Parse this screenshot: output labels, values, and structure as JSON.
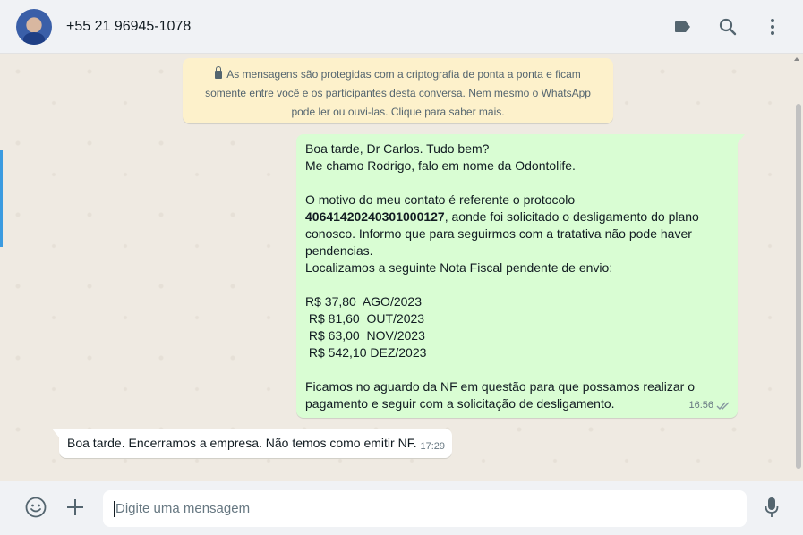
{
  "header": {
    "contact_name": "+55 21 96945-1078",
    "icons": [
      "label-icon",
      "search-icon",
      "menu-icon"
    ]
  },
  "encryption_notice": {
    "text": "As mensagens são protegidas com a criptografia de ponta a ponta e ficam somente entre você e os participantes desta conversa. Nem mesmo o WhatsApp pode ler ou ouvi-las. Clique para saber mais.",
    "line1": "As mensagens são protegidas com a criptografia de ponta a ponta e ficam",
    "line2": "somente entre você e os participantes desta conversa. Nem mesmo o WhatsApp",
    "line3": "pode ler ou ouvi-las. Clique para saber mais."
  },
  "messages": [
    {
      "direction": "outgoing",
      "lines": [
        "Boa tarde, Dr Carlos. Tudo bem?",
        "Me chamo Rodrigo, falo em nome da Odontolife.",
        "",
        "O motivo do meu contato é referente o protocolo",
        "",
        "conosco. Informo que para seguirmos com a tratativa não pode haver",
        "pendencias.",
        "Localizamos a seguinte Nota Fiscal pendente de envio:",
        "",
        "R$ 37,80  AGO/2023",
        " R$ 81,60  OUT/2023",
        " R$ 63,00  NOV/2023",
        " R$ 542,10 DEZ/2023",
        "",
        "",
        "Ficamos no aguardo da NF em questão para que possamos realizar o",
        "pagamento e seguir com a solicitação de desligamento."
      ],
      "protocol_bold": "40641420240301000127",
      "protocol_rest": ", aonde foi solicitado o desligamento do plano",
      "time": "16:56",
      "status": "read"
    },
    {
      "direction": "incoming",
      "text": "Boa tarde. Encerramos a empresa. Não temos como emitir NF.",
      "time": "17:29"
    }
  ],
  "composer": {
    "placeholder": "Digite uma mensagem",
    "value": ""
  },
  "colors": {
    "outgoing_bubble": "#d9fdd3",
    "incoming_bubble": "#ffffff",
    "notice_bg": "#fdf1cb",
    "chat_bg": "#efeae2",
    "panel_bg": "#f0f2f5"
  }
}
